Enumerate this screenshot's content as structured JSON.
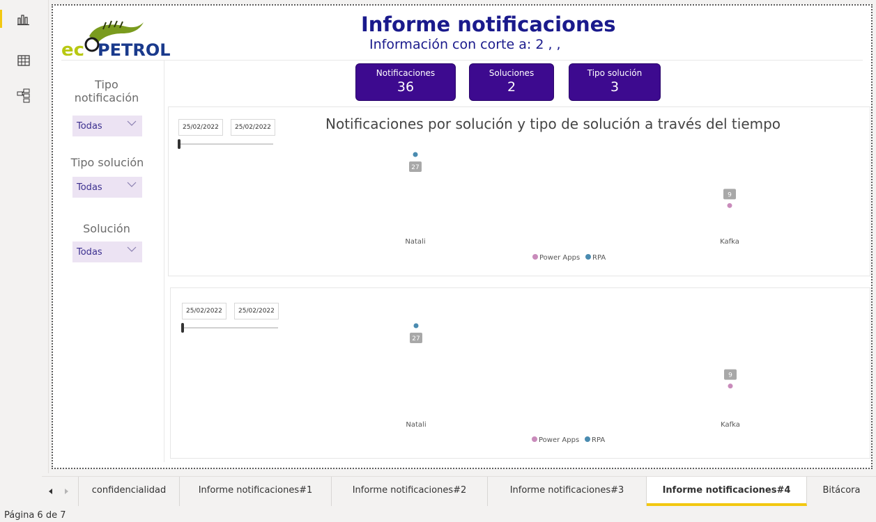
{
  "header": {
    "title": "Informe notificaciones",
    "subtitle_prefix": "Información con corte a:",
    "subtitle_value": "2 , ,",
    "logo_text": "ecopetrol"
  },
  "slicers": [
    {
      "label": "Tipo notificación",
      "value": "Todas"
    },
    {
      "label": "Tipo solución",
      "value": "Todas"
    },
    {
      "label": "Solución",
      "value": "Todas"
    }
  ],
  "cards": [
    {
      "label": "Notificaciones",
      "value": "36"
    },
    {
      "label": "Soluciones",
      "value": "2"
    },
    {
      "label": "Tipo solución",
      "value": "3"
    }
  ],
  "charts": [
    {
      "title": "Notificaciones por solución y tipo de solución a través del tiempo",
      "date_from": "25/02/2022",
      "date_to": "25/02/2022"
    },
    {
      "title": "",
      "date_from": "25/02/2022",
      "date_to": "25/02/2022"
    }
  ],
  "chart_data": [
    {
      "type": "scatter",
      "title": "Notificaciones por solución y tipo de solución a través del tiempo",
      "categories": [
        "Natali",
        "Kafka"
      ],
      "series": [
        {
          "name": "Power Apps",
          "color": "#c98bbb",
          "values": [
            null,
            9
          ]
        },
        {
          "name": "RPA",
          "color": "#4a8bb0",
          "values": [
            27,
            null
          ]
        }
      ],
      "legend": "bottom-center",
      "grid": false
    },
    {
      "type": "scatter",
      "title": "",
      "categories": [
        "Natali",
        "Kafka"
      ],
      "series": [
        {
          "name": "Power Apps",
          "color": "#c98bbb",
          "values": [
            null,
            9
          ]
        },
        {
          "name": "RPA",
          "color": "#4a8bb0",
          "values": [
            27,
            null
          ]
        }
      ],
      "legend": "bottom-center",
      "grid": false
    }
  ],
  "tabs": [
    {
      "label": "confidencialidad",
      "active": false
    },
    {
      "label": "Informe notificaciones#1",
      "active": false
    },
    {
      "label": "Informe notificaciones#2",
      "active": false
    },
    {
      "label": "Informe notificaciones#3",
      "active": false
    },
    {
      "label": "Informe notificaciones#4",
      "active": true
    },
    {
      "label": "Bitácora",
      "active": false
    }
  ],
  "status": {
    "page": "Página 6 de 7"
  },
  "colors": {
    "accent": "#3d0a8f",
    "title": "#1a1a8c",
    "active_tab": "#f2c811",
    "power_apps": "#c98bbb",
    "rpa": "#4a8bb0"
  },
  "icons": {
    "report": "bar-chart-icon",
    "data": "table-icon",
    "model": "model-icon"
  }
}
